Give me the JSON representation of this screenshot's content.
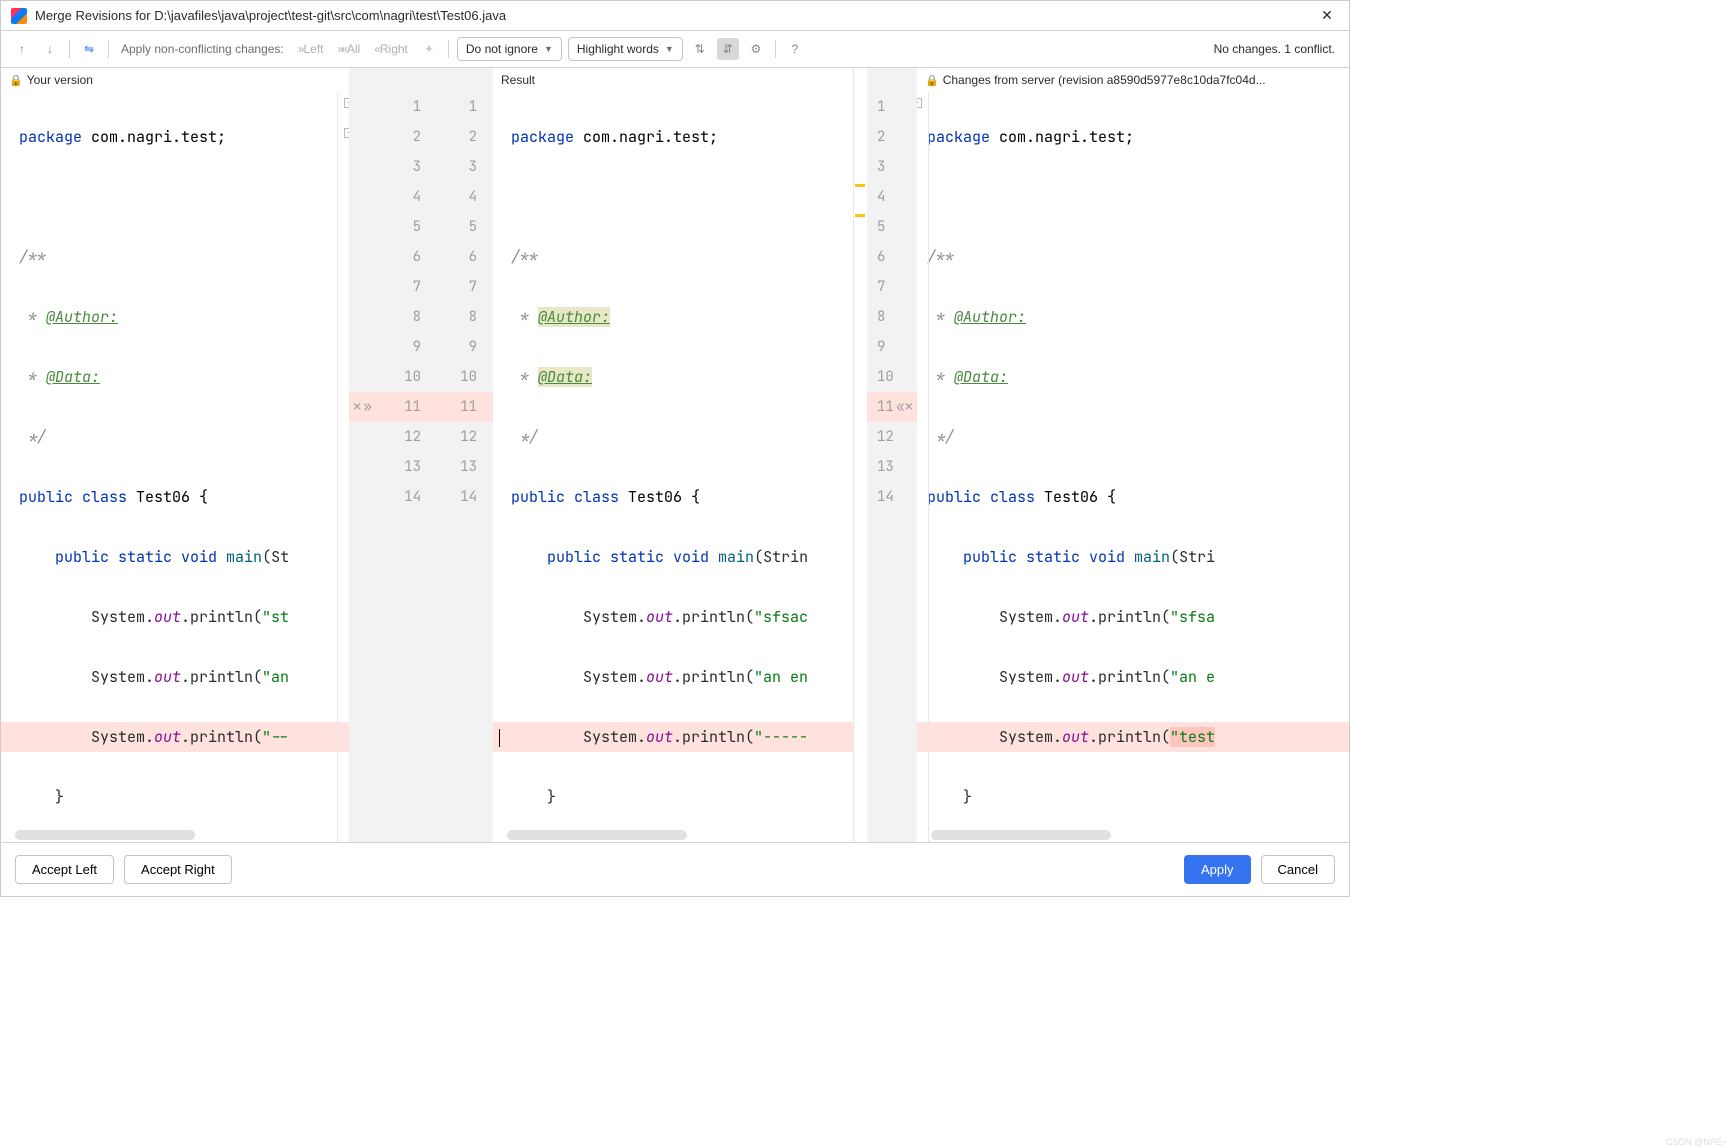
{
  "title": "Merge Revisions for D:\\javafiles\\java\\project\\test-git\\src\\com\\nagri\\test\\Test06.java",
  "toolbar": {
    "apply_label": "Apply non-conflicting changes:",
    "left": "Left",
    "all": "All",
    "right": "Right",
    "ignore_sel": "Do not ignore",
    "highlight_sel": "Highlight words",
    "status": "No changes. 1 conflict."
  },
  "panes": {
    "left_title": "Your version",
    "mid_title": "Result",
    "right_title": "Changes from server (revision a8590d5977e8c10da7fc04d..."
  },
  "code": {
    "pkg_line_a": "package ",
    "pkg_line_b": "com.nagri.test;",
    "doc_open": "/**",
    "doc_author_pre": " * ",
    "doc_author": "@Author:",
    "doc_data_pre": " * ",
    "doc_data": "@Data:",
    "doc_close": " */",
    "class_a": "public ",
    "class_b": "class ",
    "class_c": "Test06 {",
    "main_a": "    public ",
    "main_b": "static ",
    "main_c": "void ",
    "main_d": "main",
    "main_e_left": "(St",
    "main_e_mid": "(Strin",
    "main_e_right": "(Stri",
    "p1_a": "        System.",
    "p1_b": "out",
    "p1_c": ".println(",
    "p1_d_left": "\"st",
    "p1_d_mid": "\"sfsac",
    "p1_d_right": "\"sfsa",
    "p2_d_left": "\"an",
    "p2_d_mid": "\"an en",
    "p2_d_right": "\"an e",
    "p3_d_left": "\"--",
    "p3_d_mid": "\"-----",
    "p3_d_right": "\"test",
    "brace_close1": "    }",
    "brace_close2": "}"
  },
  "line_nums_left": [
    "1",
    "2",
    "3",
    "4",
    "5",
    "6",
    "7",
    "8",
    "9",
    "10",
    "11",
    "12",
    "13",
    "14"
  ],
  "line_nums_mid": [
    "1",
    "2",
    "3",
    "4",
    "5",
    "6",
    "7",
    "8",
    "9",
    "10",
    "11",
    "12",
    "13",
    "14"
  ],
  "line_nums_right": [
    "1",
    "2",
    "3",
    "4",
    "5",
    "6",
    "7",
    "8",
    "9",
    "10",
    "11",
    "12",
    "13",
    "14"
  ],
  "footer": {
    "accept_left": "Accept Left",
    "accept_right": "Accept Right",
    "apply": "Apply",
    "cancel": "Cancel"
  },
  "watermark": "CSDN @NPE~"
}
